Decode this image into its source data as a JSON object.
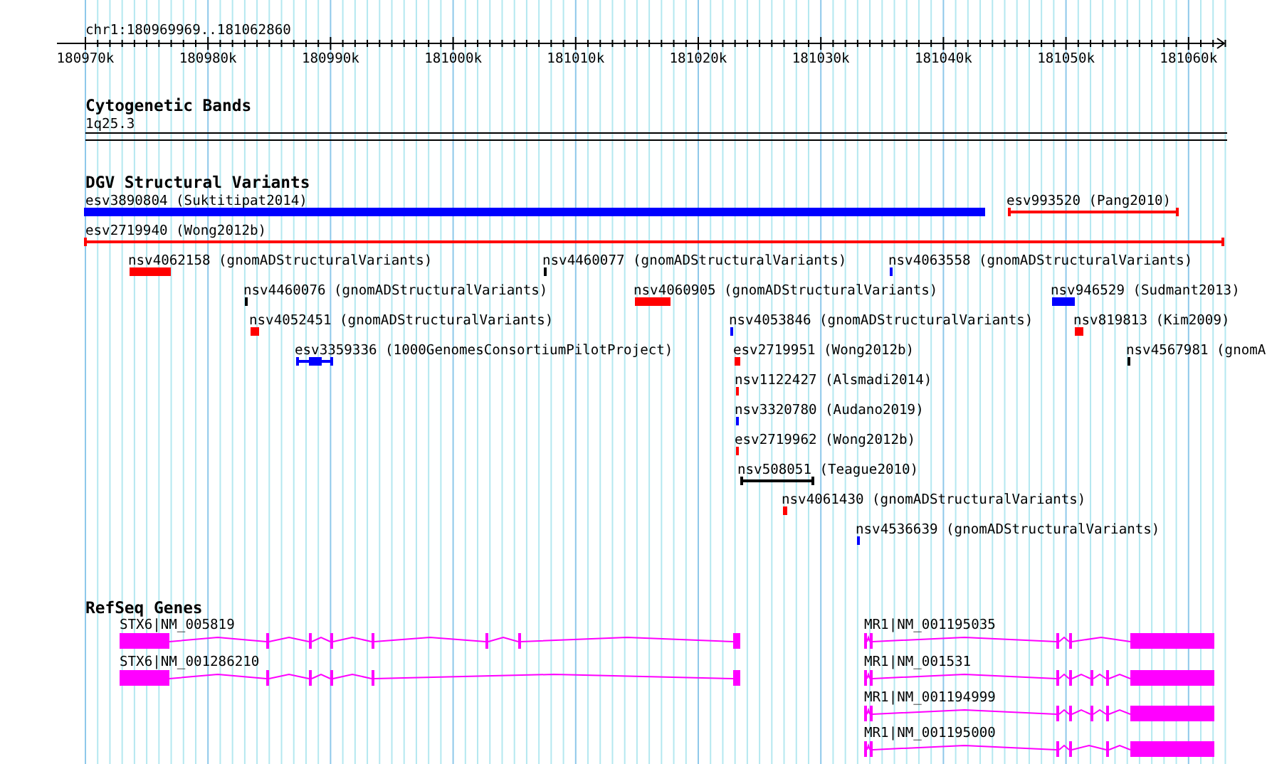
{
  "ruler": {
    "location": "chr1:180969969..181062860",
    "ticks": [
      "180970k",
      "180980k",
      "180990k",
      "181000k",
      "181010k",
      "181020k",
      "181030k",
      "181040k",
      "181050k",
      "181060k"
    ]
  },
  "cytogenetic_bands": {
    "title": "Cytogenetic Bands",
    "band": "1q25.3"
  },
  "dgv": {
    "title": "DGV Structural Variants",
    "features": [
      {
        "label": "esv3890804 (Suktitipat2014)",
        "color": "#0000ff",
        "kind": "block"
      },
      {
        "label": "esv993520 (Pang2010)",
        "color": "#ff0000",
        "kind": "span"
      },
      {
        "label": "esv2719940 (Wong2012b)",
        "color": "#ff0000",
        "kind": "span"
      },
      {
        "label": "nsv4062158 (gnomADStructuralVariants)",
        "color": "#ff0000",
        "kind": "block"
      },
      {
        "label": "nsv4460077 (gnomADStructuralVariants)",
        "color": "#000000",
        "kind": "block"
      },
      {
        "label": "nsv4063558 (gnomADStructuralVariants)",
        "color": "#0000ff",
        "kind": "block"
      },
      {
        "label": "nsv4460076 (gnomADStructuralVariants)",
        "color": "#000000",
        "kind": "block"
      },
      {
        "label": "nsv4060905 (gnomADStructuralVariants)",
        "color": "#ff0000",
        "kind": "block"
      },
      {
        "label": "nsv946529 (Sudmant2013)",
        "color": "#0000ff",
        "kind": "block"
      },
      {
        "label": "nsv4052451 (gnomADStructuralVariants)",
        "color": "#ff0000",
        "kind": "block"
      },
      {
        "label": "nsv4053846 (gnomADStructuralVariants)",
        "color": "#0000ff",
        "kind": "block"
      },
      {
        "label": "nsv819813 (Kim2009)",
        "color": "#ff0000",
        "kind": "block"
      },
      {
        "label": "esv3359336 (1000GenomesConsortiumPilotProject)",
        "color": "#0000ff",
        "kind": "gapped"
      },
      {
        "label": "esv2719951 (Wong2012b)",
        "color": "#ff0000",
        "kind": "block"
      },
      {
        "label": "nsv4567981 (gnomA",
        "color": "#000000",
        "kind": "block"
      },
      {
        "label": "nsv1122427 (Alsmadi2014)",
        "color": "#ff0000",
        "kind": "block"
      },
      {
        "label": "nsv3320780 (Audano2019)",
        "color": "#0000ff",
        "kind": "block"
      },
      {
        "label": "esv2719962 (Wong2012b)",
        "color": "#ff0000",
        "kind": "block"
      },
      {
        "label": "nsv508051 (Teague2010)",
        "color": "#000000",
        "kind": "span"
      },
      {
        "label": "nsv4061430 (gnomADStructuralVariants)",
        "color": "#ff0000",
        "kind": "block"
      },
      {
        "label": "nsv4536639 (gnomADStructuralVariants)",
        "color": "#0000ff",
        "kind": "block"
      }
    ]
  },
  "refseq_genes": {
    "title": "RefSeq Genes",
    "genes": [
      {
        "label": "STX6|NM_005819"
      },
      {
        "label": "STX6|NM_001286210"
      },
      {
        "label": "MR1|NM_001195035"
      },
      {
        "label": "MR1|NM_001531"
      },
      {
        "label": "MR1|NM_001194999"
      },
      {
        "label": "MR1|NM_001195000"
      }
    ]
  }
}
